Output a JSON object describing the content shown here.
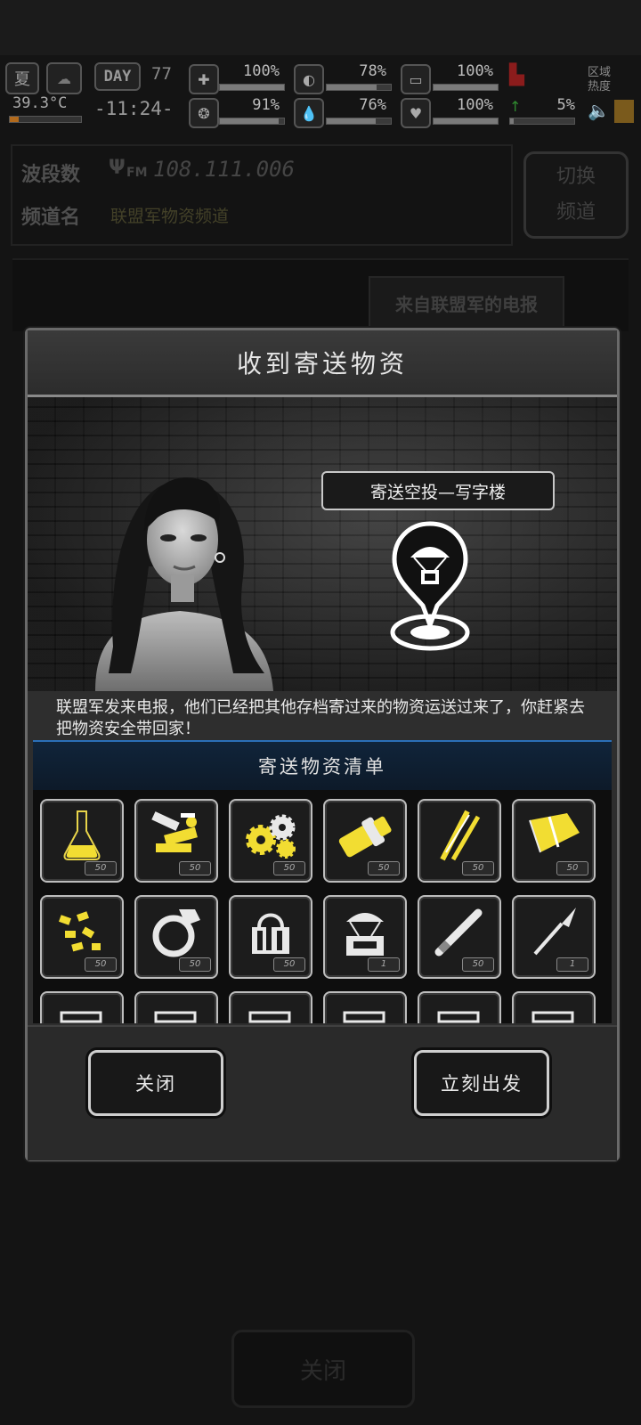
{
  "status_bar": {
    "season": "夏",
    "temperature": "39.3°C",
    "day_label": "DAY",
    "day_number": "77",
    "time": "-11:24-",
    "zone_heat_label": "区域热度",
    "stats": [
      {
        "name": "health",
        "value": "100%",
        "fill": 1.0
      },
      {
        "name": "hunger",
        "value": "78%",
        "fill": 0.78
      },
      {
        "name": "stamina",
        "value": "100%",
        "fill": 1.0
      },
      {
        "name": "sanity",
        "value": "91%",
        "fill": 0.91
      },
      {
        "name": "thirst",
        "value": "76%",
        "fill": 0.76
      },
      {
        "name": "mood",
        "value": "100%",
        "fill": 1.0
      },
      {
        "name": "infection",
        "value": "5%",
        "fill": 0.05
      }
    ]
  },
  "radio": {
    "band_label": "波段数",
    "frequency": "108.111.006",
    "fm_label": "FM",
    "channel_label": "频道名",
    "channel_name": "联盟军物资频道",
    "switch_label_1": "切换",
    "switch_label_2": "频道",
    "telegram_button": "来自联盟军的电报",
    "bottom_close": "关闭"
  },
  "dialog": {
    "title": "收到寄送物资",
    "drop_location": "寄送空投—写字楼",
    "message": "联盟军发来电报，他们已经把其他存档寄过来的物资运送过来了，你赶紧去把物资安全带回家！",
    "list_title": "寄送物资清单",
    "items": [
      {
        "icon": "flask-icon",
        "qty": "50"
      },
      {
        "icon": "tools-parts-icon",
        "qty": "50"
      },
      {
        "icon": "gears-icon",
        "qty": "50"
      },
      {
        "icon": "pipe-fitting-icon",
        "qty": "50"
      },
      {
        "icon": "wire-sticks-icon",
        "qty": "50"
      },
      {
        "icon": "metal-sheet-icon",
        "qty": "50"
      },
      {
        "icon": "nuggets-icon",
        "qty": "50"
      },
      {
        "icon": "ring-icon",
        "qty": "50"
      },
      {
        "icon": "supply-bag-icon",
        "qty": "50"
      },
      {
        "icon": "airdrop-crate-icon",
        "qty": "1"
      },
      {
        "icon": "tube-icon",
        "qty": "50"
      },
      {
        "icon": "scalpel-icon",
        "qty": "1"
      },
      {
        "icon": "blueprint-icon",
        "qty": ""
      },
      {
        "icon": "blueprint-icon",
        "qty": ""
      },
      {
        "icon": "blueprint-icon",
        "qty": ""
      },
      {
        "icon": "blueprint-icon",
        "qty": ""
      },
      {
        "icon": "blueprint-icon",
        "qty": ""
      },
      {
        "icon": "blueprint-icon",
        "qty": ""
      }
    ],
    "close_button": "关闭",
    "depart_button": "立刻出发"
  }
}
